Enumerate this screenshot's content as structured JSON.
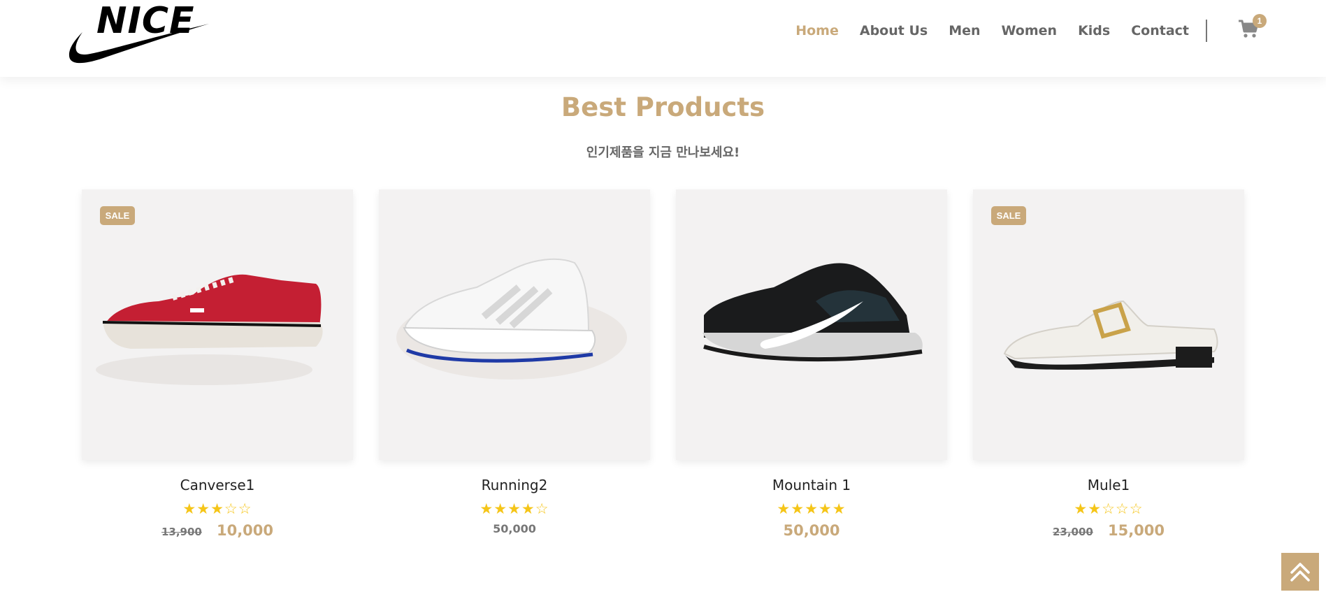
{
  "header": {
    "logo_text": "NICE",
    "nav": [
      {
        "label": "Home",
        "active": true
      },
      {
        "label": "About Us",
        "active": false
      },
      {
        "label": "Men",
        "active": false
      },
      {
        "label": "Women",
        "active": false
      },
      {
        "label": "Kids",
        "active": false
      },
      {
        "label": "Contact",
        "active": false
      }
    ],
    "cart_count": "1",
    "icons": {
      "cart": "cart-icon",
      "top": "double-chevron-up-icon"
    }
  },
  "section": {
    "title": "Best Products",
    "subtitle": "인기제품을 지금 만나보세요!"
  },
  "products": [
    {
      "name": "Canverse1",
      "sale_badge": "SALE",
      "rating": 3,
      "old_price": "13,900",
      "price": "10,000"
    },
    {
      "name": "Running2",
      "rating": 4,
      "price": "50,000"
    },
    {
      "name": "Mountain 1",
      "rating": 5,
      "price": "50,000"
    },
    {
      "name": "Mule1",
      "sale_badge": "SALE",
      "rating": 2,
      "old_price": "23,000",
      "price": "15,000"
    }
  ],
  "colors": {
    "accent": "#c9a97a",
    "star": "#f5c518",
    "card_bg": "#f3f2f2"
  }
}
